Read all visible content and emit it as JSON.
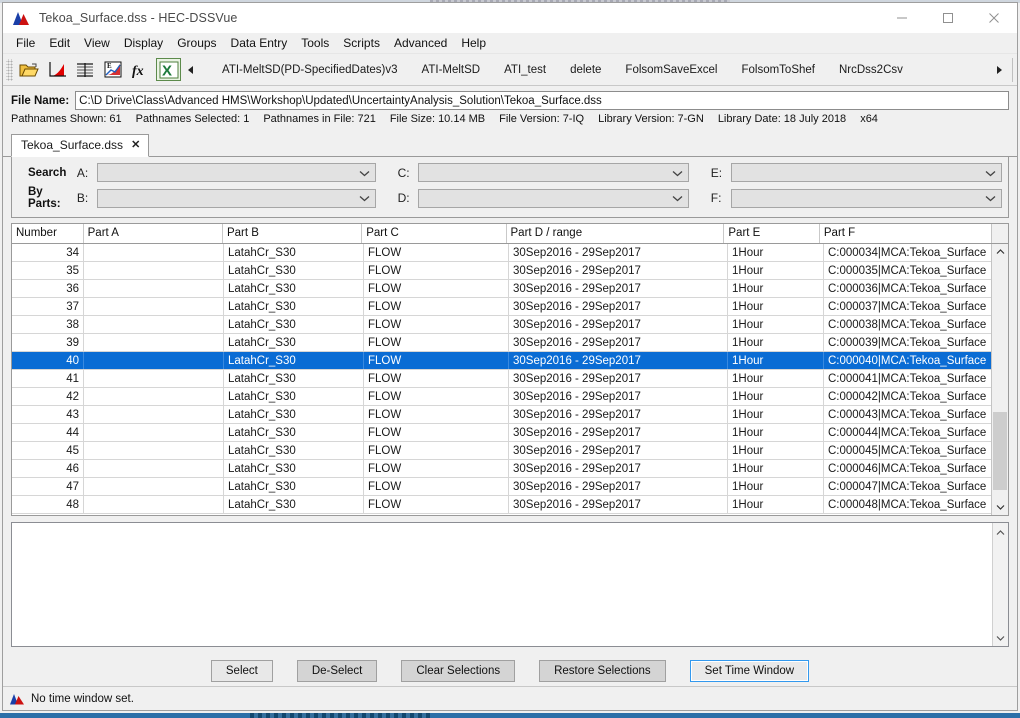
{
  "window": {
    "title": "Tekoa_Surface.dss - HEC-DSSVue",
    "logo_icon": "hec-mountain-logo-icon",
    "controls": {
      "minimize": "minimize-icon",
      "maximize": "maximize-icon",
      "close": "close-icon"
    }
  },
  "menubar": {
    "items": [
      "File",
      "Edit",
      "View",
      "Display",
      "Groups",
      "Data Entry",
      "Tools",
      "Scripts",
      "Advanced",
      "Help"
    ]
  },
  "toolbar": {
    "icons": [
      "open-folder-icon",
      "plot-chart-icon",
      "tabulate-icon",
      "edit-chart-icon",
      "math-function-icon",
      "excel-export-icon"
    ],
    "scroll_left_icon": "triangle-left-icon",
    "scroll_right_icon": "triangle-right-icon",
    "scripts": [
      "ATI-MeltSD(PD-SpecifiedDates)v3",
      "ATI-MeltSD",
      "ATI_test",
      "delete",
      "FolsomSaveExcel",
      "FolsomToShef",
      "NrcDss2Csv"
    ]
  },
  "file": {
    "label": "File Name:",
    "path": "C:\\D Drive\\Class\\Advanced HMS\\Workshop\\Updated\\UncertaintyAnalysis_Solution\\Tekoa_Surface.dss",
    "stats": [
      {
        "label": "Pathnames Shown:",
        "value": "61"
      },
      {
        "label": "Pathnames Selected:",
        "value": "1"
      },
      {
        "label": "Pathnames in File:",
        "value": "721"
      },
      {
        "label": "File Size:",
        "value": "10.14  MB"
      },
      {
        "label": "File Version:",
        "value": "7-IQ"
      },
      {
        "label": "Library Version:",
        "value": "7-GN"
      },
      {
        "label": "Library Date:",
        "value": "18 July 2018"
      },
      {
        "label": "x64",
        "value": ""
      }
    ]
  },
  "tab": {
    "label": "Tekoa_Surface.dss",
    "close_icon": "close-tab-icon"
  },
  "search": {
    "title_line1": "Search",
    "title_line2": "By Parts:",
    "parts": [
      {
        "key": "A:",
        "value": "",
        "placeholder": ""
      },
      {
        "key": "B:",
        "value": "",
        "placeholder": ""
      },
      {
        "key": "C:",
        "value": "",
        "placeholder": ""
      },
      {
        "key": "D:",
        "value": "",
        "placeholder": ""
      },
      {
        "key": "E:",
        "value": "",
        "placeholder": ""
      },
      {
        "key": "F:",
        "value": "",
        "placeholder": ""
      }
    ],
    "chevron_icon": "chevron-down-icon"
  },
  "table": {
    "columns": [
      "Number",
      "Part A",
      "Part B",
      "Part C",
      "Part D / range",
      "Part E",
      "Part F"
    ],
    "selected_row_index": 6,
    "rows": [
      {
        "number": "34",
        "a": "",
        "b": "LatahCr_S30",
        "c": "FLOW",
        "d": "30Sep2016 - 29Sep2017",
        "e": "1Hour",
        "f": "C:000034|MCA:Tekoa_Surface"
      },
      {
        "number": "35",
        "a": "",
        "b": "LatahCr_S30",
        "c": "FLOW",
        "d": "30Sep2016 - 29Sep2017",
        "e": "1Hour",
        "f": "C:000035|MCA:Tekoa_Surface"
      },
      {
        "number": "36",
        "a": "",
        "b": "LatahCr_S30",
        "c": "FLOW",
        "d": "30Sep2016 - 29Sep2017",
        "e": "1Hour",
        "f": "C:000036|MCA:Tekoa_Surface"
      },
      {
        "number": "37",
        "a": "",
        "b": "LatahCr_S30",
        "c": "FLOW",
        "d": "30Sep2016 - 29Sep2017",
        "e": "1Hour",
        "f": "C:000037|MCA:Tekoa_Surface"
      },
      {
        "number": "38",
        "a": "",
        "b": "LatahCr_S30",
        "c": "FLOW",
        "d": "30Sep2016 - 29Sep2017",
        "e": "1Hour",
        "f": "C:000038|MCA:Tekoa_Surface"
      },
      {
        "number": "39",
        "a": "",
        "b": "LatahCr_S30",
        "c": "FLOW",
        "d": "30Sep2016 - 29Sep2017",
        "e": "1Hour",
        "f": "C:000039|MCA:Tekoa_Surface"
      },
      {
        "number": "40",
        "a": "",
        "b": "LatahCr_S30",
        "c": "FLOW",
        "d": "30Sep2016 - 29Sep2017",
        "e": "1Hour",
        "f": "C:000040|MCA:Tekoa_Surface"
      },
      {
        "number": "41",
        "a": "",
        "b": "LatahCr_S30",
        "c": "FLOW",
        "d": "30Sep2016 - 29Sep2017",
        "e": "1Hour",
        "f": "C:000041|MCA:Tekoa_Surface"
      },
      {
        "number": "42",
        "a": "",
        "b": "LatahCr_S30",
        "c": "FLOW",
        "d": "30Sep2016 - 29Sep2017",
        "e": "1Hour",
        "f": "C:000042|MCA:Tekoa_Surface"
      },
      {
        "number": "43",
        "a": "",
        "b": "LatahCr_S30",
        "c": "FLOW",
        "d": "30Sep2016 - 29Sep2017",
        "e": "1Hour",
        "f": "C:000043|MCA:Tekoa_Surface"
      },
      {
        "number": "44",
        "a": "",
        "b": "LatahCr_S30",
        "c": "FLOW",
        "d": "30Sep2016 - 29Sep2017",
        "e": "1Hour",
        "f": "C:000044|MCA:Tekoa_Surface"
      },
      {
        "number": "45",
        "a": "",
        "b": "LatahCr_S30",
        "c": "FLOW",
        "d": "30Sep2016 - 29Sep2017",
        "e": "1Hour",
        "f": "C:000045|MCA:Tekoa_Surface"
      },
      {
        "number": "46",
        "a": "",
        "b": "LatahCr_S30",
        "c": "FLOW",
        "d": "30Sep2016 - 29Sep2017",
        "e": "1Hour",
        "f": "C:000046|MCA:Tekoa_Surface"
      },
      {
        "number": "47",
        "a": "",
        "b": "LatahCr_S30",
        "c": "FLOW",
        "d": "30Sep2016 - 29Sep2017",
        "e": "1Hour",
        "f": "C:000047|MCA:Tekoa_Surface"
      },
      {
        "number": "48",
        "a": "",
        "b": "LatahCr_S30",
        "c": "FLOW",
        "d": "30Sep2016 - 29Sep2017",
        "e": "1Hour",
        "f": "C:000048|MCA:Tekoa_Surface"
      }
    ],
    "scrollbar": {
      "up_icon": "chevron-up-icon",
      "down_icon": "chevron-down-icon"
    }
  },
  "selection_panel": {
    "content": "",
    "scroll_up_icon": "chevron-up-icon",
    "scroll_down_icon": "chevron-down-icon"
  },
  "buttons": [
    {
      "label": "Select",
      "style": "light"
    },
    {
      "label": "De-Select",
      "style": "normal"
    },
    {
      "label": "Clear Selections",
      "style": "normal"
    },
    {
      "label": "Restore Selections",
      "style": "normal"
    },
    {
      "label": "Set Time Window",
      "style": "focused"
    }
  ],
  "statusbar": {
    "icon": "hec-mountain-logo-icon",
    "text": "No time window set."
  },
  "colors": {
    "selection_blue": "#0a6cd4",
    "focus_blue": "#3399ee",
    "window_bg": "#f0f0f0",
    "taskbar_blue": "#2b6fa8"
  }
}
